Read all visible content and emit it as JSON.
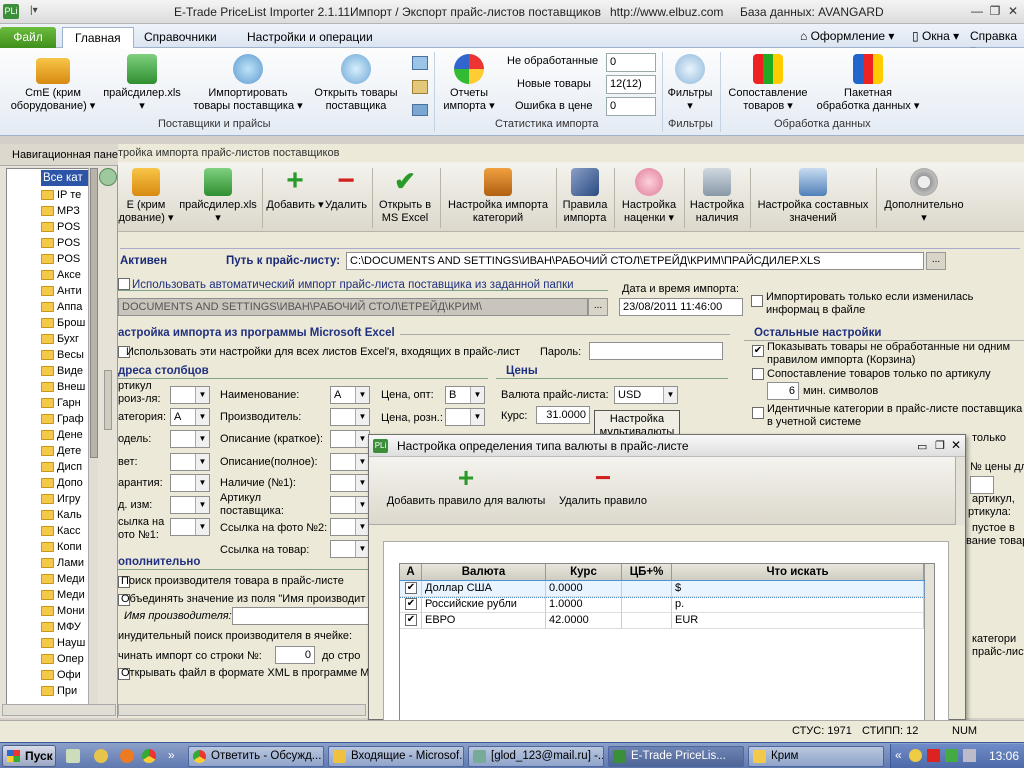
{
  "titlebar": {
    "app_title": "E-Trade PriceList Importer 2.1.11",
    "subtitle": "Импорт / Экспорт прайс-листов поставщиков",
    "url": "http://www.elbuz.com",
    "db": "База данных: AVANGARD"
  },
  "ribbon_tabs": [
    "Файл",
    "Главная",
    "Справочники",
    "Настройки и операции"
  ],
  "ribbon_right": {
    "style": "Оформление",
    "windows": "Окна",
    "help": "Справка"
  },
  "ribbon": {
    "buttons": [
      {
        "label1": "CmE (крим",
        "label2": "оборудование)",
        "icon": "truck-icon"
      },
      {
        "label1": "прайсдилер.xls",
        "label2": "",
        "icon": "excel-icon"
      },
      {
        "label1": "Импортировать",
        "label2": "товары поставщика",
        "icon": "import-icon"
      },
      {
        "label1": "Открыть товары",
        "label2": "поставщика",
        "icon": "open-goods-icon"
      },
      {
        "label1": "Отчеты",
        "label2": "импорта",
        "icon": "pie-chart-icon"
      },
      {
        "label1": "Фильтры",
        "label2": "",
        "icon": "filter-icon"
      },
      {
        "label1": "Сопоставление",
        "label2": "товаров",
        "icon": "rubik-icon"
      },
      {
        "label1": "Пакетная",
        "label2": "обработка данных",
        "icon": "batch-icon"
      }
    ],
    "groups": [
      "Поставщики и прайсы",
      "Статистика импорта",
      "Фильтры",
      "Обработка данных"
    ],
    "stats": [
      {
        "label": "Не обработанные",
        "value": "0"
      },
      {
        "label": "Новые товары",
        "value": "12(12)"
      },
      {
        "label": "Ошибка в цене",
        "value": "0"
      }
    ]
  },
  "nav": {
    "title": "Навигационная пане",
    "root": "Все кат",
    "items": [
      "IP те",
      "МРЗ",
      "POS",
      "POS",
      "POS",
      "Аксе",
      "Анти",
      "Аппа",
      "Брош",
      "Бухг",
      "Весы",
      "Виде",
      "Внеш",
      "Гарн",
      "Граф",
      "Дене",
      "Дете",
      "Дисп",
      "Допо",
      "Игру",
      "Каль",
      "Касс",
      "Копи",
      "Лами",
      "Меди",
      "Меди",
      "Мони",
      "МФУ",
      "Науш",
      "Опер",
      "Офи",
      "При"
    ]
  },
  "main": {
    "subtab": "тройка импорта прайс-листов поставщиков",
    "toolbar": [
      {
        "label1": "Е (крим",
        "label2": "дование)",
        "icon": "truck-icon"
      },
      {
        "label1": "прайсдилер.xls",
        "label2": "",
        "icon": "excel-icon"
      },
      {
        "label1": "Добавить",
        "label2": "",
        "icon": "plus-icon"
      },
      {
        "label1": "Удалить",
        "label2": "",
        "icon": "minus-icon"
      },
      {
        "label1": "Открыть в",
        "label2": "MS Excel",
        "icon": "checkmark-icon"
      },
      {
        "label1": "Настройка импорта",
        "label2": "категорий",
        "icon": "categories-icon"
      },
      {
        "label1": "Правила",
        "label2": "импорта",
        "icon": "quill-icon"
      },
      {
        "label1": "Настройка",
        "label2": "наценки",
        "icon": "piggy-icon"
      },
      {
        "label1": "Настройка",
        "label2": "наличия",
        "icon": "cart-icon"
      },
      {
        "label1": "Настройка составных",
        "label2": "значений",
        "icon": "composite-icon"
      },
      {
        "label1": "Дополнительно",
        "label2": "",
        "icon": "gear-icon"
      }
    ],
    "active": "Активен",
    "path_label": "Путь к прайс-листу:",
    "path_value": "C:\\DOCUMENTS AND SETTINGS\\ИВАН\\РАБОЧИЙ СТОЛ\\ЕТРЕЙД\\КРИМ\\ПРАЙСДИЛЕР.XLS",
    "auto_import": "Использовать автоматический импорт прайс-листа поставщика из заданной папки",
    "auto_folder": "DOCUMENTS AND SETTINGS\\ИВАН\\РАБОЧИЙ СТОЛ\\ЕТРЕЙД\\КРИМ\\",
    "date_label": "Дата и время импорта:",
    "date_value": "23/08/2011 11:46:00",
    "import_if_changed": "Импортировать только если изменилась информац в файле",
    "excel_section": "астройка импорта из программы Microsoft Excel",
    "use_all_sheets": "Использовать эти настройки для всех листов Excel'я, входящих в прайс-лист",
    "password_label": "Пароль:",
    "columns_section": "дреса столбцов",
    "prices_section": "Цены",
    "other_section": "Остальные настройки",
    "col_left": [
      {
        "label": "ртикул",
        "value": ""
      },
      {
        "label": "роиз-ля:",
        "value": ""
      },
      {
        "label": "атегория:",
        "value": "A"
      },
      {
        "label": "одель:",
        "value": ""
      },
      {
        "label": "вет:",
        "value": ""
      },
      {
        "label": "арантия:",
        "value": ""
      },
      {
        "label": "д. изм:",
        "value": ""
      },
      {
        "label": "сылка на",
        "value": ""
      },
      {
        "label": "ото №1:",
        "value": ""
      }
    ],
    "col_mid": [
      {
        "label": "Наименование:",
        "value": "A"
      },
      {
        "label": "Производитель:",
        "value": ""
      },
      {
        "label": "Описание (краткое):",
        "value": ""
      },
      {
        "label": "Описание(полное):",
        "value": ""
      },
      {
        "label": "Наличие (№1):",
        "value": ""
      },
      {
        "label": "Артикул",
        "value": ""
      },
      {
        "label": "поставщика:",
        "value": ""
      },
      {
        "label": "Ссылка на фото №2:",
        "value": ""
      },
      {
        "label": "Ссылка на товар:",
        "value": ""
      }
    ],
    "price_opt_label": "Цена, опт:",
    "price_opt_value": "B",
    "price_retail_label": "Цена, розн.:",
    "currency_label": "Валюта прайс-листа:",
    "currency_value": "USD",
    "rate_label": "Курс:",
    "rate_value": "31.0000",
    "multicurrency": "Настройка мультивалюты",
    "other_settings": [
      "Показывать товары не обработанные ни одним правилом импорта (Корзина)",
      "Сопоставление товаров только по артикулу",
      "мин. символов",
      "Идентичные категории в прайс-листе поставщика в учетной системе"
    ],
    "min_symbols": "6",
    "partial_right": [
      "только",
      "№ цены дл",
      "артикул,",
      "ртикула:",
      "пустое в",
      "вание товар",
      "категори",
      "прайс-листе"
    ],
    "additional_section": "ополнительно",
    "search_manuf": "Поиск производителя товара в прайс-листе",
    "merge_values": "Объединять значение из поля \"Имя производит",
    "manuf_name_label": "Имя производителя:",
    "forced_search": "инудительный поиск производителя в ячейке:",
    "start_row_label": "чинать импорт со строки №:",
    "start_row_value": "0",
    "to_row_label": "до стро",
    "open_xml": "Открывать файл в формате XML в программе M"
  },
  "dialog": {
    "title": "Настройка определения типа валюты в прайс-листе",
    "add_label": "Добавить правило для валюты",
    "delete_label": "Удалить правило",
    "columns": [
      "A",
      "Валюта",
      "Курс",
      "ЦБ+%",
      "Что искать"
    ],
    "rows": [
      {
        "checked": true,
        "currency": "Доллар США",
        "rate": "0.0000",
        "cb": "",
        "search": "$"
      },
      {
        "checked": true,
        "currency": "Российские рубли",
        "rate": "1.0000",
        "cb": "",
        "search": "р."
      },
      {
        "checked": true,
        "currency": "ЕВРО",
        "rate": "42.0000",
        "cb": "",
        "search": "EUR"
      }
    ]
  },
  "statusbar": {
    "stus": "СТУС: 1971",
    "stipp": "СТИПП: 12",
    "num": "NUM"
  },
  "taskbar": {
    "start": "Пуск",
    "tasks": [
      "Ответить - Обсужд...",
      "Входящие - Microsof...",
      "[glod_123@mail.ru] -...",
      "E-Trade PriceLis...",
      "Крим"
    ],
    "clock": "13:06"
  },
  "colors": {
    "ribbon_accent": "#4e8f2a",
    "section_title": "#1a2a78",
    "dialog_border": "#6f6f6f"
  }
}
